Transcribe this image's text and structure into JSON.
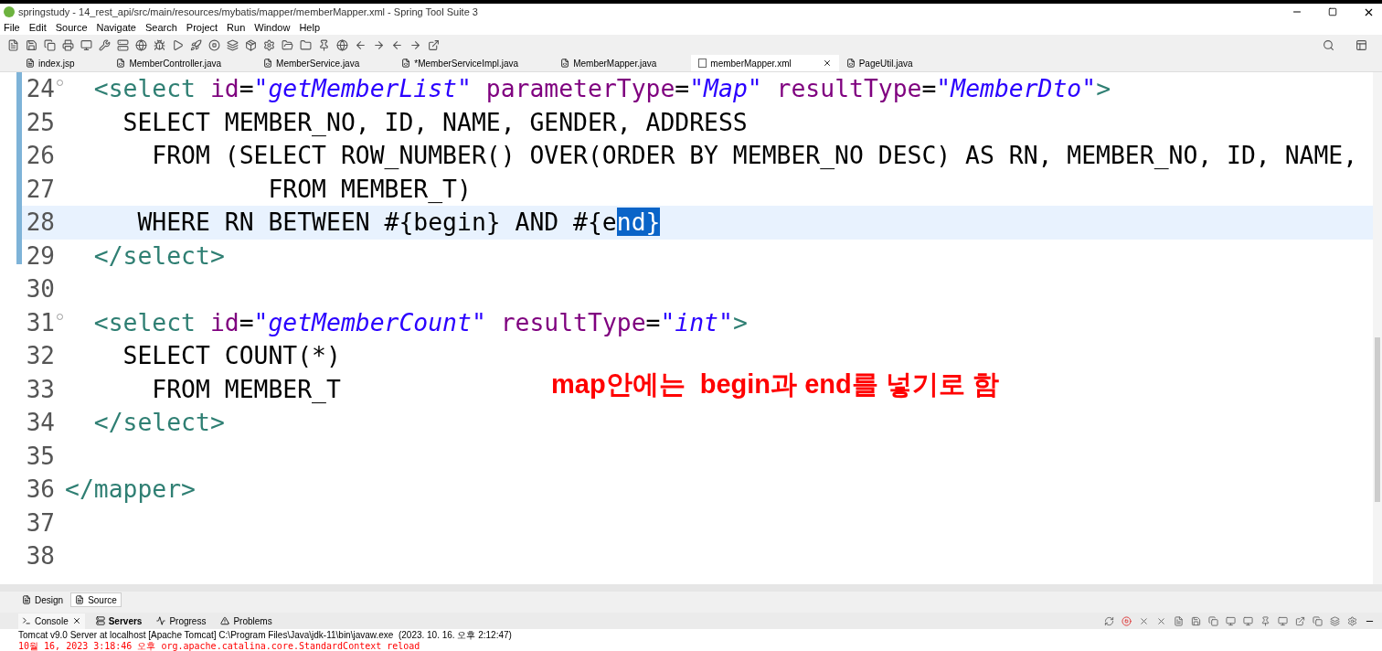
{
  "window": {
    "title": "springstudy - 14_rest_api/src/main/resources/mybatis/mapper/memberMapper.xml - Spring Tool Suite 3"
  },
  "menu": [
    "File",
    "Edit",
    "Source",
    "Navigate",
    "Search",
    "Project",
    "Run",
    "Window",
    "Help"
  ],
  "editor_tabs": [
    {
      "label": "index.jsp",
      "kind": "file",
      "selected": false
    },
    {
      "label": "MemberController.java",
      "kind": "java",
      "selected": false
    },
    {
      "label": "MemberService.java",
      "kind": "java",
      "selected": false
    },
    {
      "label": "*MemberServiceImpl.java",
      "kind": "java",
      "selected": false
    },
    {
      "label": "MemberMapper.java",
      "kind": "java",
      "selected": false
    },
    {
      "label": "memberMapper.xml",
      "kind": "xml",
      "selected": true
    },
    {
      "label": "PageUtil.java",
      "kind": "java",
      "selected": false
    }
  ],
  "code_lines": [
    {
      "number": "24",
      "folding": true,
      "current": false,
      "tokens": [
        {
          "kind": "tag",
          "text": "  <select"
        },
        {
          "kind": "attr",
          "text": " id"
        },
        {
          "kind": "plain",
          "text": "="
        },
        {
          "kind": "value",
          "text": "\"getMemberList\""
        },
        {
          "kind": "attr",
          "text": " parameterType"
        },
        {
          "kind": "plain",
          "text": "="
        },
        {
          "kind": "value",
          "text": "\"Map\""
        },
        {
          "kind": "attr",
          "text": " resultType"
        },
        {
          "kind": "plain",
          "text": "="
        },
        {
          "kind": "value",
          "text": "\"MemberDto\""
        },
        {
          "kind": "tag",
          "text": ">"
        }
      ]
    },
    {
      "number": "25",
      "folding": false,
      "current": false,
      "tokens": [
        {
          "kind": "plain",
          "text": "    SELECT MEMBER_NO, ID, NAME, GENDER, ADDRESS"
        }
      ]
    },
    {
      "number": "26",
      "folding": false,
      "current": false,
      "tokens": [
        {
          "kind": "plain",
          "text": "      FROM (SELECT ROW_NUMBER() OVER(ORDER BY MEMBER_NO DESC) AS RN, MEMBER_NO, ID, NAME,"
        }
      ]
    },
    {
      "number": "27",
      "folding": false,
      "current": false,
      "tokens": [
        {
          "kind": "plain",
          "text": "              FROM MEMBER_T)"
        }
      ]
    },
    {
      "number": "28",
      "folding": false,
      "current": true,
      "tokens": [
        {
          "kind": "plain",
          "text": "     WHERE RN BETWEEN #{begin} AND #{e"
        },
        {
          "kind": "selected",
          "text": "nd}"
        }
      ]
    },
    {
      "number": "29",
      "folding": false,
      "current": false,
      "tokens": [
        {
          "kind": "tag",
          "text": "  </select>"
        }
      ]
    },
    {
      "number": "30",
      "folding": false,
      "current": false
    },
    {
      "number": "31",
      "folding": true,
      "current": false,
      "tokens": [
        {
          "kind": "tag",
          "text": "  <select"
        },
        {
          "kind": "attr",
          "text": " id"
        },
        {
          "kind": "plain",
          "text": "="
        },
        {
          "kind": "value",
          "text": "\"getMemberCount\""
        },
        {
          "kind": "attr",
          "text": " resultType"
        },
        {
          "kind": "plain",
          "text": "="
        },
        {
          "kind": "value",
          "text": "\"int\""
        },
        {
          "kind": "tag",
          "text": ">"
        }
      ]
    },
    {
      "number": "32",
      "folding": false,
      "current": false,
      "tokens": [
        {
          "kind": "plain",
          "text": "    SELECT COUNT(*)"
        }
      ]
    },
    {
      "number": "33",
      "folding": false,
      "current": false,
      "tokens": [
        {
          "kind": "plain",
          "text": "      FROM MEMBER_T"
        }
      ]
    },
    {
      "number": "34",
      "folding": false,
      "current": false,
      "tokens": [
        {
          "kind": "tag",
          "text": "  </select>"
        }
      ]
    },
    {
      "number": "35",
      "folding": false,
      "current": false
    },
    {
      "number": "36",
      "folding": false,
      "current": false,
      "tokens": [
        {
          "kind": "tag",
          "text": "</mapper>"
        }
      ]
    },
    {
      "number": "37",
      "folding": false,
      "current": false
    },
    {
      "number": "38",
      "folding": false,
      "current": false
    }
  ],
  "annotation": "map안에는  begin과 end를 넣기로 함",
  "view_tabs": [
    {
      "label": "Design",
      "selected": false
    },
    {
      "label": "Source",
      "selected": true
    }
  ],
  "console_tabs": [
    {
      "label": "Console",
      "selected": true
    },
    {
      "label": "Servers",
      "selected": false
    },
    {
      "label": "Progress",
      "selected": false
    },
    {
      "label": "Problems",
      "selected": false
    }
  ],
  "console": {
    "process": "Tomcat v9.0 Server at localhost [Apache Tomcat] C:\\Program Files\\Java\\jdk-11\\bin\\javaw.exe  (2023. 10. 16. 오후 2:12:47)",
    "output": "10월 16, 2023 3:18:46 오후 org.apache.catalina.core.StandardContext reload"
  }
}
